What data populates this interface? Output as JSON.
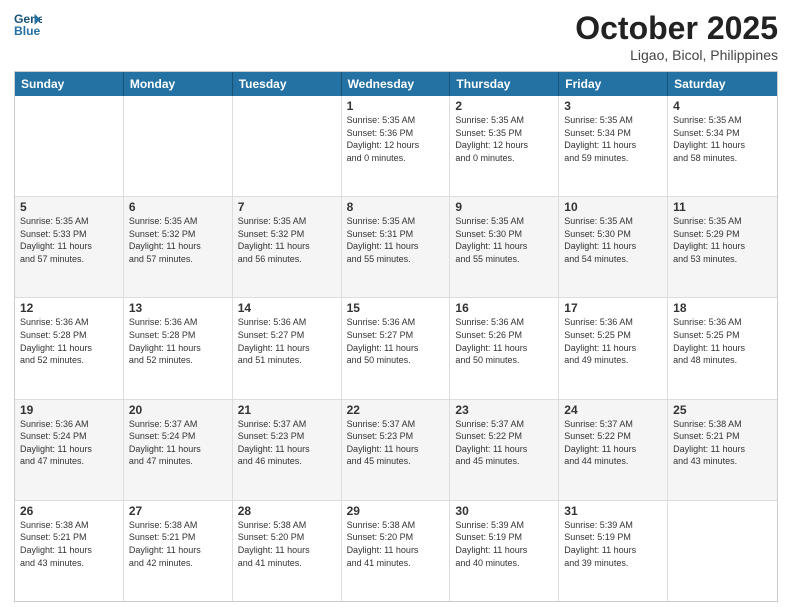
{
  "header": {
    "logo_line1": "General",
    "logo_line2": "Blue",
    "month": "October 2025",
    "location": "Ligao, Bicol, Philippines"
  },
  "days_of_week": [
    "Sunday",
    "Monday",
    "Tuesday",
    "Wednesday",
    "Thursday",
    "Friday",
    "Saturday"
  ],
  "weeks": [
    [
      {
        "day": "",
        "lines": []
      },
      {
        "day": "",
        "lines": []
      },
      {
        "day": "",
        "lines": []
      },
      {
        "day": "1",
        "lines": [
          "Sunrise: 5:35 AM",
          "Sunset: 5:36 PM",
          "Daylight: 12 hours",
          "and 0 minutes."
        ]
      },
      {
        "day": "2",
        "lines": [
          "Sunrise: 5:35 AM",
          "Sunset: 5:35 PM",
          "Daylight: 12 hours",
          "and 0 minutes."
        ]
      },
      {
        "day": "3",
        "lines": [
          "Sunrise: 5:35 AM",
          "Sunset: 5:34 PM",
          "Daylight: 11 hours",
          "and 59 minutes."
        ]
      },
      {
        "day": "4",
        "lines": [
          "Sunrise: 5:35 AM",
          "Sunset: 5:34 PM",
          "Daylight: 11 hours",
          "and 58 minutes."
        ]
      }
    ],
    [
      {
        "day": "5",
        "lines": [
          "Sunrise: 5:35 AM",
          "Sunset: 5:33 PM",
          "Daylight: 11 hours",
          "and 57 minutes."
        ]
      },
      {
        "day": "6",
        "lines": [
          "Sunrise: 5:35 AM",
          "Sunset: 5:32 PM",
          "Daylight: 11 hours",
          "and 57 minutes."
        ]
      },
      {
        "day": "7",
        "lines": [
          "Sunrise: 5:35 AM",
          "Sunset: 5:32 PM",
          "Daylight: 11 hours",
          "and 56 minutes."
        ]
      },
      {
        "day": "8",
        "lines": [
          "Sunrise: 5:35 AM",
          "Sunset: 5:31 PM",
          "Daylight: 11 hours",
          "and 55 minutes."
        ]
      },
      {
        "day": "9",
        "lines": [
          "Sunrise: 5:35 AM",
          "Sunset: 5:30 PM",
          "Daylight: 11 hours",
          "and 55 minutes."
        ]
      },
      {
        "day": "10",
        "lines": [
          "Sunrise: 5:35 AM",
          "Sunset: 5:30 PM",
          "Daylight: 11 hours",
          "and 54 minutes."
        ]
      },
      {
        "day": "11",
        "lines": [
          "Sunrise: 5:35 AM",
          "Sunset: 5:29 PM",
          "Daylight: 11 hours",
          "and 53 minutes."
        ]
      }
    ],
    [
      {
        "day": "12",
        "lines": [
          "Sunrise: 5:36 AM",
          "Sunset: 5:28 PM",
          "Daylight: 11 hours",
          "and 52 minutes."
        ]
      },
      {
        "day": "13",
        "lines": [
          "Sunrise: 5:36 AM",
          "Sunset: 5:28 PM",
          "Daylight: 11 hours",
          "and 52 minutes."
        ]
      },
      {
        "day": "14",
        "lines": [
          "Sunrise: 5:36 AM",
          "Sunset: 5:27 PM",
          "Daylight: 11 hours",
          "and 51 minutes."
        ]
      },
      {
        "day": "15",
        "lines": [
          "Sunrise: 5:36 AM",
          "Sunset: 5:27 PM",
          "Daylight: 11 hours",
          "and 50 minutes."
        ]
      },
      {
        "day": "16",
        "lines": [
          "Sunrise: 5:36 AM",
          "Sunset: 5:26 PM",
          "Daylight: 11 hours",
          "and 50 minutes."
        ]
      },
      {
        "day": "17",
        "lines": [
          "Sunrise: 5:36 AM",
          "Sunset: 5:25 PM",
          "Daylight: 11 hours",
          "and 49 minutes."
        ]
      },
      {
        "day": "18",
        "lines": [
          "Sunrise: 5:36 AM",
          "Sunset: 5:25 PM",
          "Daylight: 11 hours",
          "and 48 minutes."
        ]
      }
    ],
    [
      {
        "day": "19",
        "lines": [
          "Sunrise: 5:36 AM",
          "Sunset: 5:24 PM",
          "Daylight: 11 hours",
          "and 47 minutes."
        ]
      },
      {
        "day": "20",
        "lines": [
          "Sunrise: 5:37 AM",
          "Sunset: 5:24 PM",
          "Daylight: 11 hours",
          "and 47 minutes."
        ]
      },
      {
        "day": "21",
        "lines": [
          "Sunrise: 5:37 AM",
          "Sunset: 5:23 PM",
          "Daylight: 11 hours",
          "and 46 minutes."
        ]
      },
      {
        "day": "22",
        "lines": [
          "Sunrise: 5:37 AM",
          "Sunset: 5:23 PM",
          "Daylight: 11 hours",
          "and 45 minutes."
        ]
      },
      {
        "day": "23",
        "lines": [
          "Sunrise: 5:37 AM",
          "Sunset: 5:22 PM",
          "Daylight: 11 hours",
          "and 45 minutes."
        ]
      },
      {
        "day": "24",
        "lines": [
          "Sunrise: 5:37 AM",
          "Sunset: 5:22 PM",
          "Daylight: 11 hours",
          "and 44 minutes."
        ]
      },
      {
        "day": "25",
        "lines": [
          "Sunrise: 5:38 AM",
          "Sunset: 5:21 PM",
          "Daylight: 11 hours",
          "and 43 minutes."
        ]
      }
    ],
    [
      {
        "day": "26",
        "lines": [
          "Sunrise: 5:38 AM",
          "Sunset: 5:21 PM",
          "Daylight: 11 hours",
          "and 43 minutes."
        ]
      },
      {
        "day": "27",
        "lines": [
          "Sunrise: 5:38 AM",
          "Sunset: 5:21 PM",
          "Daylight: 11 hours",
          "and 42 minutes."
        ]
      },
      {
        "day": "28",
        "lines": [
          "Sunrise: 5:38 AM",
          "Sunset: 5:20 PM",
          "Daylight: 11 hours",
          "and 41 minutes."
        ]
      },
      {
        "day": "29",
        "lines": [
          "Sunrise: 5:38 AM",
          "Sunset: 5:20 PM",
          "Daylight: 11 hours",
          "and 41 minutes."
        ]
      },
      {
        "day": "30",
        "lines": [
          "Sunrise: 5:39 AM",
          "Sunset: 5:19 PM",
          "Daylight: 11 hours",
          "and 40 minutes."
        ]
      },
      {
        "day": "31",
        "lines": [
          "Sunrise: 5:39 AM",
          "Sunset: 5:19 PM",
          "Daylight: 11 hours",
          "and 39 minutes."
        ]
      },
      {
        "day": "",
        "lines": []
      }
    ]
  ]
}
